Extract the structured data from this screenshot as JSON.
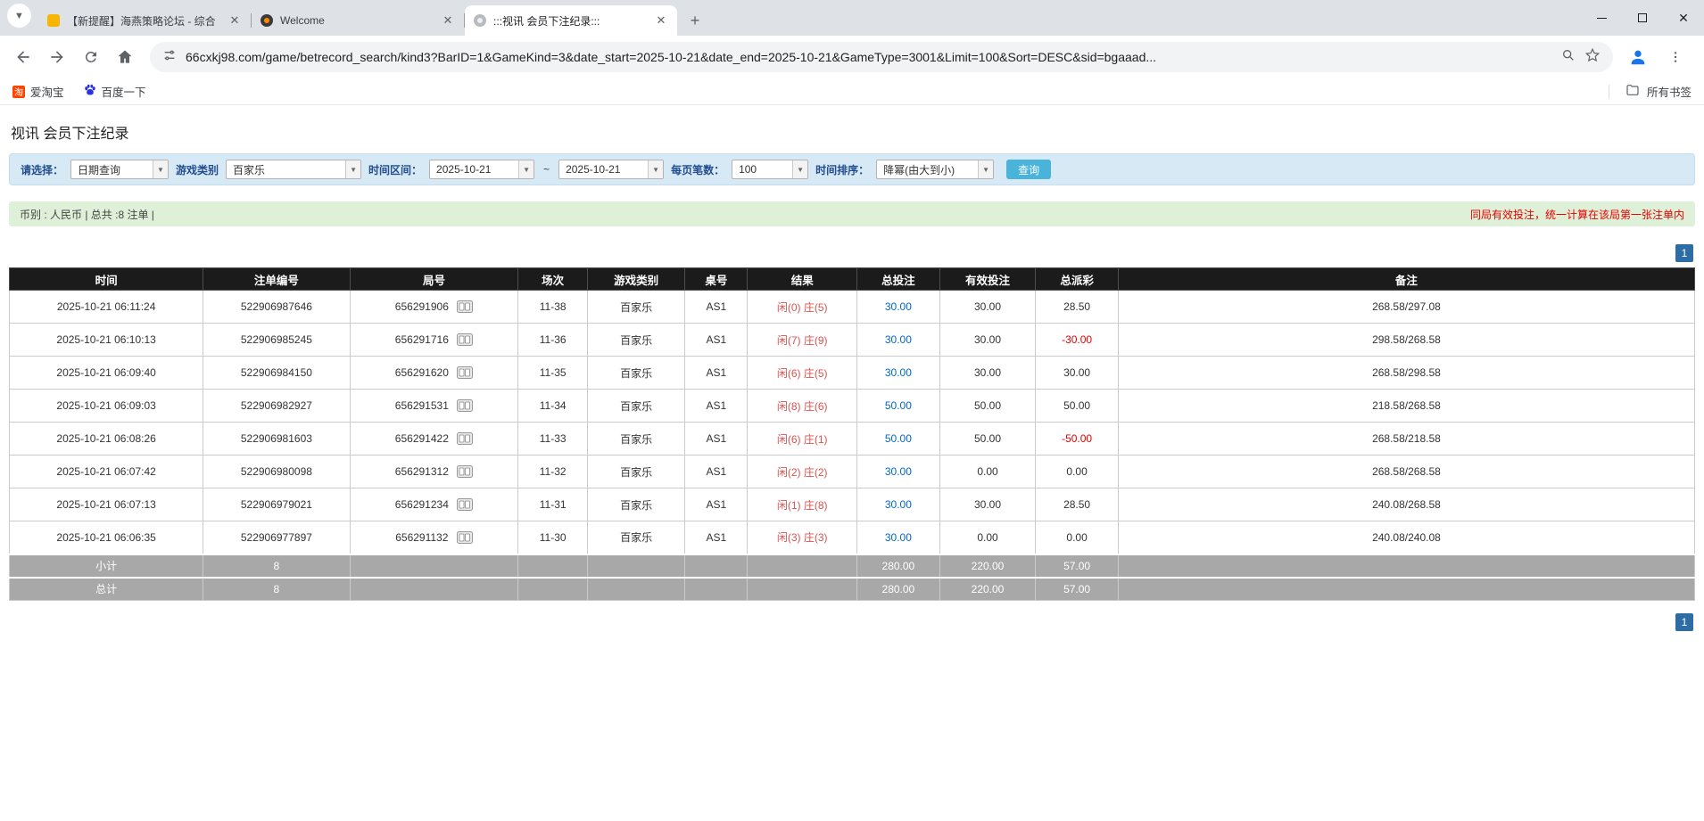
{
  "browser": {
    "tabs": [
      {
        "title": "【新提醒】海燕策略论坛 - 综合"
      },
      {
        "title": "Welcome"
      },
      {
        "title": ":::视讯 会员下注纪录:::"
      }
    ],
    "new_tab_label": "+",
    "url": "66cxkj98.com/game/betrecord_search/kind3?BarID=1&GameKind=3&date_start=2025-10-21&date_end=2025-10-21&GameType=3001&Limit=100&Sort=DESC&sid=bgaaad...",
    "bookmarks": {
      "taobao": "爱淘宝",
      "taobao_icon_char": "淘",
      "baidu": "百度一下",
      "all_bookmarks": "所有书签"
    }
  },
  "page": {
    "title": "视讯 会员下注纪录",
    "filter": {
      "select_label": "请选择：",
      "select_value": "日期查询",
      "game_label": "游戏类别",
      "game_value": "百家乐",
      "range_label": "时间区间：",
      "date_start": "2025-10-21",
      "tilde": "~",
      "date_end": "2025-10-21",
      "page_size_label": "每页笔数：",
      "page_size_value": "100",
      "sort_label": "时间排序：",
      "sort_value": "降幂(由大到小)",
      "search_button": "查询"
    },
    "summary": {
      "left": "币别 : 人民币 | 总共 :8 注单 |",
      "right": "同局有效投注，统一计算在该局第一张注单内"
    },
    "pagination": "1",
    "table": {
      "headers": [
        "时间",
        "注单编号",
        "局号",
        "场次",
        "游戏类别",
        "桌号",
        "结果",
        "总投注",
        "有效投注",
        "总派彩",
        "备注"
      ],
      "rows": [
        {
          "time": "2025-10-21 06:11:24",
          "bet_id": "522906987646",
          "round_id": "656291906",
          "session": "11-38",
          "game": "百家乐",
          "table_no": "AS1",
          "result_player": "闲(0)",
          "result_banker": "庄(5)",
          "total_bet": "30.00",
          "valid_bet": "30.00",
          "payout": "28.50",
          "note": "268.58/297.08"
        },
        {
          "time": "2025-10-21 06:10:13",
          "bet_id": "522906985245",
          "round_id": "656291716",
          "session": "11-36",
          "game": "百家乐",
          "table_no": "AS1",
          "result_player": "闲(7)",
          "result_banker": "庄(9)",
          "total_bet": "30.00",
          "valid_bet": "30.00",
          "payout": "-30.00",
          "note": "298.58/268.58"
        },
        {
          "time": "2025-10-21 06:09:40",
          "bet_id": "522906984150",
          "round_id": "656291620",
          "session": "11-35",
          "game": "百家乐",
          "table_no": "AS1",
          "result_player": "闲(6)",
          "result_banker": "庄(5)",
          "total_bet": "30.00",
          "valid_bet": "30.00",
          "payout": "30.00",
          "note": "268.58/298.58"
        },
        {
          "time": "2025-10-21 06:09:03",
          "bet_id": "522906982927",
          "round_id": "656291531",
          "session": "11-34",
          "game": "百家乐",
          "table_no": "AS1",
          "result_player": "闲(8)",
          "result_banker": "庄(6)",
          "total_bet": "50.00",
          "valid_bet": "50.00",
          "payout": "50.00",
          "note": "218.58/268.58"
        },
        {
          "time": "2025-10-21 06:08:26",
          "bet_id": "522906981603",
          "round_id": "656291422",
          "session": "11-33",
          "game": "百家乐",
          "table_no": "AS1",
          "result_player": "闲(6)",
          "result_banker": "庄(1)",
          "total_bet": "50.00",
          "valid_bet": "50.00",
          "payout": "-50.00",
          "note": "268.58/218.58"
        },
        {
          "time": "2025-10-21 06:07:42",
          "bet_id": "522906980098",
          "round_id": "656291312",
          "session": "11-32",
          "game": "百家乐",
          "table_no": "AS1",
          "result_player": "闲(2)",
          "result_banker": "庄(2)",
          "total_bet": "30.00",
          "valid_bet": "0.00",
          "payout": "0.00",
          "note": "268.58/268.58"
        },
        {
          "time": "2025-10-21 06:07:13",
          "bet_id": "522906979021",
          "round_id": "656291234",
          "session": "11-31",
          "game": "百家乐",
          "table_no": "AS1",
          "result_player": "闲(1)",
          "result_banker": "庄(8)",
          "total_bet": "30.00",
          "valid_bet": "30.00",
          "payout": "28.50",
          "note": "240.08/268.58"
        },
        {
          "time": "2025-10-21 06:06:35",
          "bet_id": "522906977897",
          "round_id": "656291132",
          "session": "11-30",
          "game": "百家乐",
          "table_no": "AS1",
          "result_player": "闲(3)",
          "result_banker": "庄(3)",
          "total_bet": "30.00",
          "valid_bet": "0.00",
          "payout": "0.00",
          "note": "240.08/240.08"
        }
      ],
      "subtotal": {
        "label": "小计",
        "count": "8",
        "total_bet": "280.00",
        "valid_bet": "220.00",
        "payout": "57.00"
      },
      "total": {
        "label": "总计",
        "count": "8",
        "total_bet": "280.00",
        "valid_bet": "220.00",
        "payout": "57.00"
      }
    }
  }
}
